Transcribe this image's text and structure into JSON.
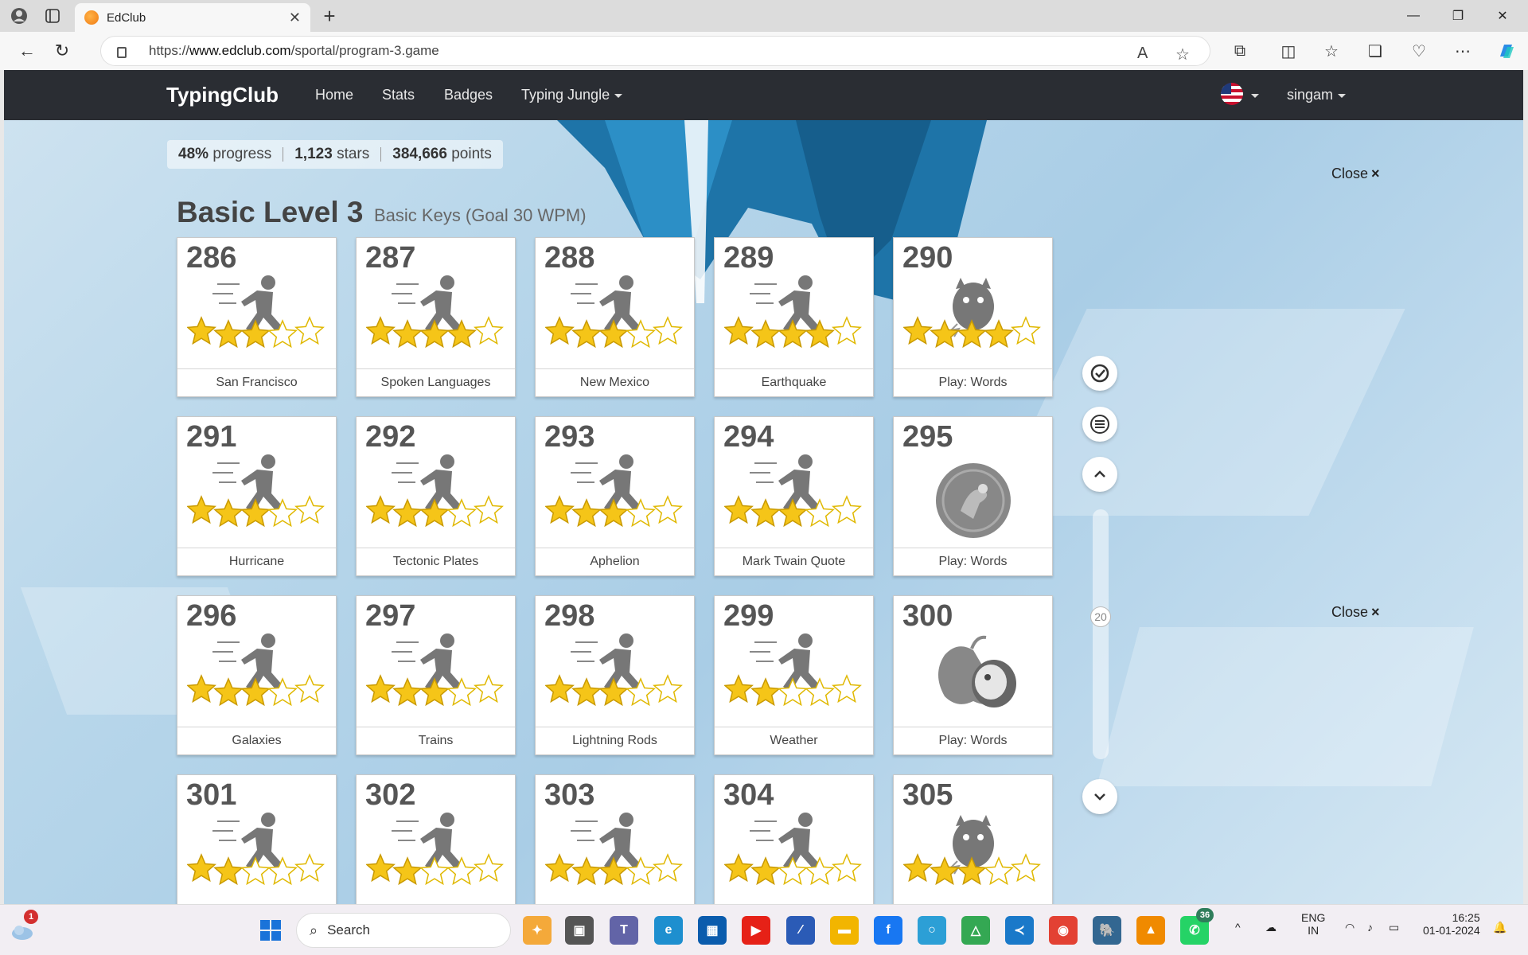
{
  "browser": {
    "tab_title": "EdClub",
    "url_prefix": "https://",
    "url_domain": "www.edclub.com",
    "url_path": "/sportal/program-3.game"
  },
  "navbar": {
    "brand": "TypingClub",
    "links": [
      "Home",
      "Stats",
      "Badges",
      "Typing Jungle"
    ],
    "user": "singam"
  },
  "stats": {
    "progress_value": "48%",
    "progress_label": "progress",
    "stars_value": "1,123",
    "stars_label": "stars",
    "points_value": "384,666",
    "points_label": "points"
  },
  "close_label": "Close",
  "close_symbol": "×",
  "level": {
    "title": "Basic Level 3",
    "subtitle": "Basic Keys (Goal 30 WPM)"
  },
  "lessons": [
    {
      "num": "286",
      "label": "San Francisco",
      "type": "runner",
      "stars": 3
    },
    {
      "num": "287",
      "label": "Spoken Languages",
      "type": "runner",
      "stars": 4
    },
    {
      "num": "288",
      "label": "New Mexico",
      "type": "runner",
      "stars": 3
    },
    {
      "num": "289",
      "label": "Earthquake",
      "type": "runner",
      "stars": 4
    },
    {
      "num": "290",
      "label": "Play: Words",
      "type": "monster",
      "stars": 4
    },
    {
      "num": "291",
      "label": "Hurricane",
      "type": "runner",
      "stars": 3
    },
    {
      "num": "292",
      "label": "Tectonic Plates",
      "type": "runner",
      "stars": 3
    },
    {
      "num": "293",
      "label": "Aphelion",
      "type": "runner",
      "stars": 3
    },
    {
      "num": "294",
      "label": "Mark Twain Quote",
      "type": "runner",
      "stars": 3
    },
    {
      "num": "295",
      "label": "Play: Words",
      "type": "game-circle",
      "stars": 0
    },
    {
      "num": "296",
      "label": "Galaxies",
      "type": "runner",
      "stars": 3
    },
    {
      "num": "297",
      "label": "Trains",
      "type": "runner",
      "stars": 3
    },
    {
      "num": "298",
      "label": "Lightning Rods",
      "type": "runner",
      "stars": 3
    },
    {
      "num": "299",
      "label": "Weather",
      "type": "runner",
      "stars": 2
    },
    {
      "num": "300",
      "label": "Play: Words",
      "type": "apple",
      "stars": 0
    },
    {
      "num": "301",
      "label": "",
      "type": "runner",
      "stars": 2
    },
    {
      "num": "302",
      "label": "",
      "type": "runner",
      "stars": 2
    },
    {
      "num": "303",
      "label": "",
      "type": "runner",
      "stars": 3
    },
    {
      "num": "304",
      "label": "",
      "type": "runner",
      "stars": 2
    },
    {
      "num": "305",
      "label": "",
      "type": "monster",
      "stars": 3
    }
  ],
  "scroll_page": "20",
  "taskbar": {
    "search_placeholder": "Search",
    "weather_badge": "1",
    "whatsapp_badge": "36",
    "lang_line1": "ENG",
    "lang_line2": "IN",
    "time": "16:25",
    "date": "01-01-2024"
  },
  "colors": {
    "navbar": "#2a2d33",
    "star_gold": "#f5c518",
    "star_empty": "#ffffff"
  }
}
